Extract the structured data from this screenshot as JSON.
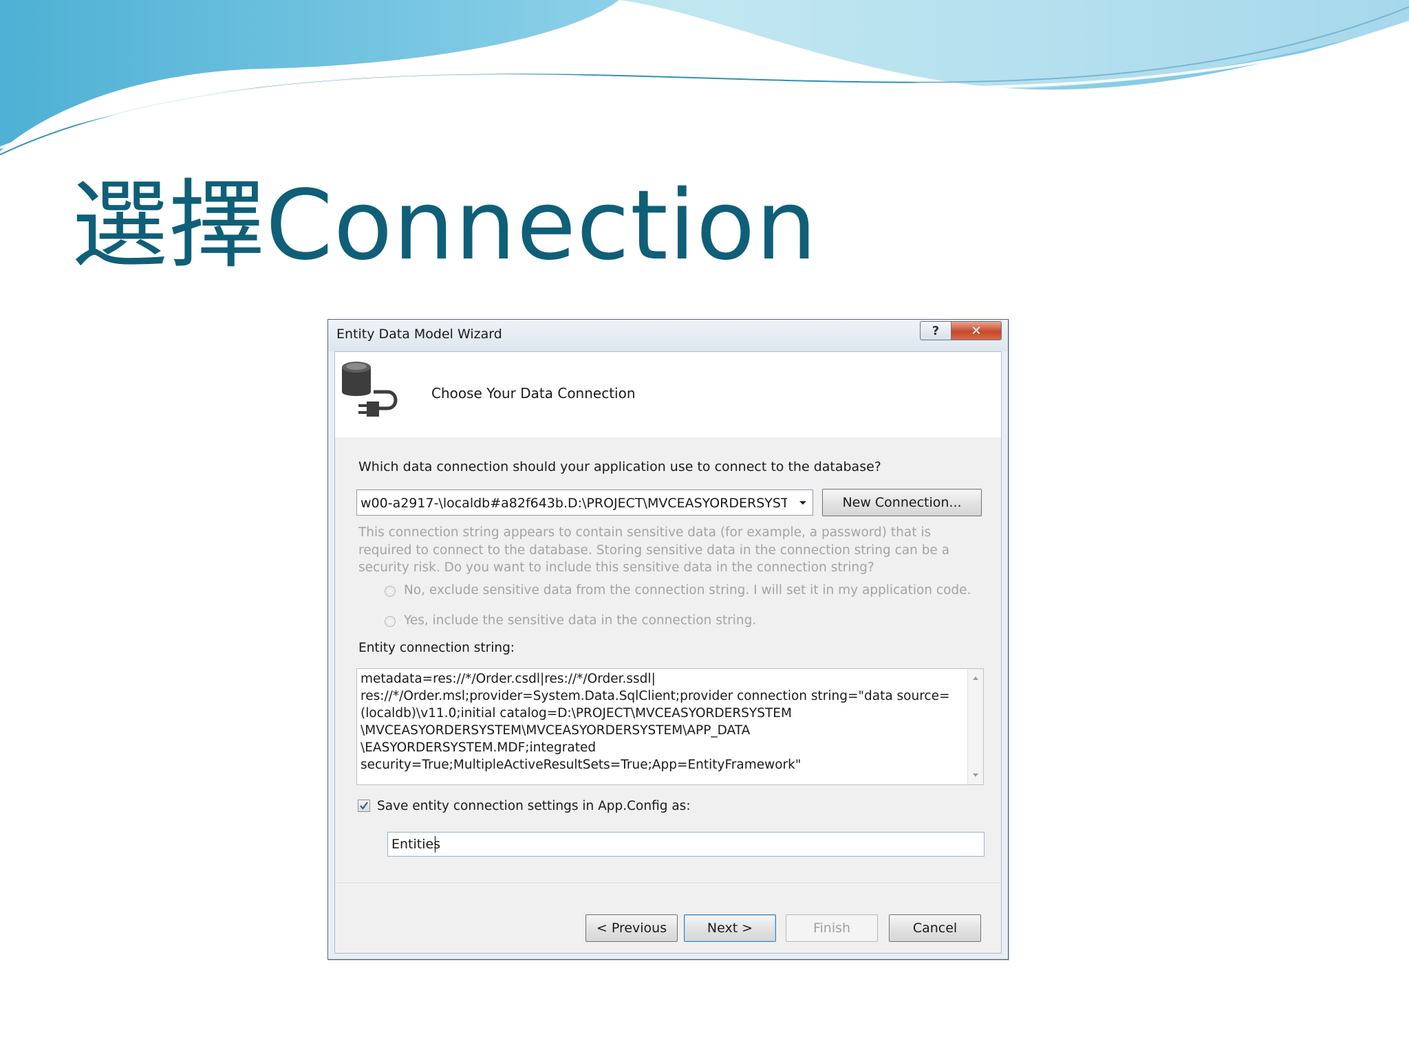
{
  "slide": {
    "title": "選擇Connection"
  },
  "colors": {
    "title": "#0f5f78",
    "wave_teal": "#5fc8dc",
    "wave_blue": "#3a9fcf",
    "dialog_accent": "#3c7fb1"
  },
  "dialog": {
    "window_title": "Entity Data Model Wizard",
    "help_label": "?",
    "close_label": "✕",
    "icon": "database-plug-icon",
    "header_title": "Choose Your Data Connection",
    "question": "Which data connection should your application use to connect to the database?",
    "connection_select": {
      "value": "w00-a2917-\\localdb#a82f643b.D:\\PROJECT\\MVCEASYORDERSYSTEM\\"
    },
    "new_connection_label": "New Connection...",
    "sensitive_text": "This connection string appears to contain sensitive data (for example, a password) that is required to connect to the database. Storing sensitive data in the connection string can be a security risk. Do you want to include this sensitive data in the connection string?",
    "radio_no": "No, exclude sensitive data from the connection string. I will set it in my application code.",
    "radio_yes": "Yes, include the sensitive data in the connection string.",
    "entity_label": "Entity connection string:",
    "entity_lines": [
      "metadata=res://*/Order.csdl|res://*/Order.ssdl|",
      "res://*/Order.msl;provider=System.Data.SqlClient;provider connection string=\"data source=",
      "(localdb)\\v11.0;initial catalog=D:\\PROJECT\\MVCEASYORDERSYSTEM",
      "\\MVCEASYORDERSYSTEM\\MVCEASYORDERSYSTEM\\APP_DATA",
      "\\EASYORDERSYSTEM.MDF;integrated",
      "security=True;MultipleActiveResultSets=True;App=EntityFramework\""
    ],
    "save_settings_label": "Save entity connection settings in App.Config as:",
    "save_settings_checked": true,
    "connection_name": "Entities",
    "buttons": {
      "previous": "< Previous",
      "next": "Next >",
      "finish": "Finish",
      "cancel": "Cancel"
    }
  }
}
